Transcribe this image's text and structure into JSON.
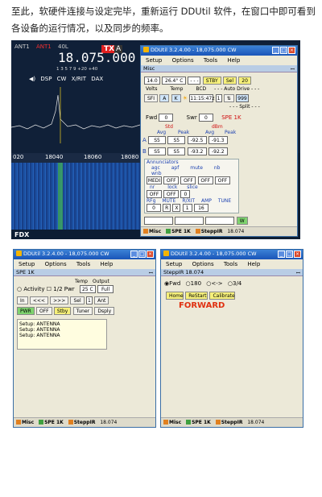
{
  "caption": "至此，软硬件连接与设定完毕，重新运行 DDUtil 软件，在窗口中即可看到各设备的运行情况，以及同步的频率。",
  "radio": {
    "ant1": "ANT1",
    "ant1b": "ANT1",
    "ant_extra": "40L",
    "tx_label": "TX",
    "tx2_label": "A",
    "frequency": "18.075.000",
    "scale_text": "1  3  5  7  9  +20 +40",
    "modes": [
      "DSP",
      "CW",
      "X/RIT",
      "DAX"
    ],
    "axis_ticks": [
      "020",
      "18040",
      "18060",
      "18080"
    ],
    "footer": "FDX"
  },
  "main_window": {
    "title": "DDUtil 3.2.4.00 - 18,075.000  CW",
    "menu": [
      "Setup",
      "Options",
      "Tools",
      "Help"
    ],
    "panel": "Misc",
    "row1": [
      "14.0",
      "26.4° C",
      "- - -",
      "STBY",
      "Sel",
      "20"
    ],
    "labels1": [
      "Volts",
      "Temp",
      "BCD",
      "- - - Auto Drive - - -"
    ],
    "sfi_row": [
      "SFI",
      "A",
      "K",
      "11:15:47z",
      "1",
      "999"
    ],
    "split_label": "- - - Split - - -",
    "fwd_label": "Fwd",
    "fwd_val": "0",
    "swr_label": "Swr",
    "swr_val": "0",
    "spe_label": "SPE 1K",
    "std_label": "Std",
    "dbm_label": "dBm",
    "avg_label": "Avg",
    "peak_label": "Peak",
    "row_a": [
      "A",
      "S5",
      "S5",
      "-92.5",
      "-91.3"
    ],
    "row_b": [
      "B",
      "S5",
      "S5",
      "-93.2",
      "-92.2"
    ],
    "annunciators": "Annunciators",
    "ann_labels": [
      "agc",
      "apf",
      "mute",
      "nb",
      "wnb"
    ],
    "ann_vals": [
      "MEDI",
      "OFF",
      "OFF",
      "OFF",
      "OFF"
    ],
    "nr_labels": [
      "nr",
      "lock",
      "slice"
    ],
    "nr_vals": [
      "OFF",
      "OFF",
      "0"
    ],
    "rf_labels": [
      "RFg",
      "MUTE",
      "R/XIT",
      "AMP",
      "TUNE"
    ],
    "rf_vals": [
      "0",
      "R",
      "X",
      "1",
      "16"
    ],
    "w_button": "W",
    "status": [
      "Misc",
      "SPE 1K",
      "SteppIR",
      "18.074"
    ]
  },
  "spe_window": {
    "title": "DDUtil 3.2.4.00 - 18,075.000  CW",
    "menu": [
      "Setup",
      "Options",
      "Tools",
      "Help"
    ],
    "panel": "SPE 1K",
    "temp_label": "Temp",
    "output_label": "Output",
    "activity_label": "Activity",
    "pwr_half": "1/2 Pwr",
    "temp_val": "25 C",
    "output_val": "Full",
    "btn_row1": [
      "In",
      "<<<",
      ">>>",
      "Sel",
      "1",
      "Ant"
    ],
    "btn_row2": [
      "PWR",
      "OFF",
      "Stby",
      "Tuner",
      "Dsply"
    ],
    "log": [
      "Setup: ANTENNA",
      "Setup: ANTENNA",
      "Setup: ANTENNA"
    ],
    "status": [
      "Misc",
      "SPE 1K",
      "SteppIR",
      "18.074"
    ]
  },
  "steppir_window": {
    "title": "DDUtil 3.2.4.00 - 18,075.000  CW",
    "menu": [
      "Setup",
      "Options",
      "Tools",
      "Help"
    ],
    "panel": "SteppIR  18.074",
    "dir_options": [
      "Fwd",
      "180",
      "<->",
      "3/4"
    ],
    "buttons": [
      "Home",
      "ReStart",
      "Calibrate"
    ],
    "direction": "FORWARD",
    "status": [
      "Misc",
      "SPE 1K",
      "SteppIR",
      "18.074"
    ]
  },
  "colors": {
    "accent_red": "#e03010",
    "green_btn": "#7ed36e",
    "yellow_btn": "#f6f07a",
    "title_blue": "#1a55b8"
  }
}
